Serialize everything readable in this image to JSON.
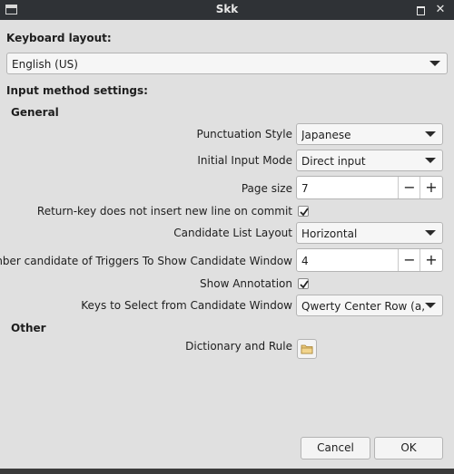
{
  "window": {
    "title": "Skk"
  },
  "keyboard": {
    "label": "Keyboard layout:",
    "selected": "English (US)"
  },
  "settings": {
    "heading": "Input method settings:",
    "general": {
      "heading": "General",
      "punctuation_style": {
        "label": "Punctuation Style",
        "value": "Japanese"
      },
      "initial_input_mode": {
        "label": "Initial Input Mode",
        "value": "Direct input"
      },
      "page_size": {
        "label": "Page size",
        "value": "7"
      },
      "return_key": {
        "label": "Return-key does not insert new line on commit",
        "checked": true
      },
      "candidate_list_layout": {
        "label": "Candidate List Layout",
        "value": "Horizontal"
      },
      "number_candidate": {
        "label": "Number candidate of Triggers To Show Candidate Window",
        "value": "4"
      },
      "show_annotation": {
        "label": "Show Annotation",
        "checked": true
      },
      "keys_to_select": {
        "label": "Keys to Select from Candidate Window",
        "value": "Qwerty Center Row (a,s,d,...)"
      }
    },
    "other": {
      "heading": "Other",
      "dictionary_and_rule": {
        "label": "Dictionary and Rule",
        "icon": "folder-icon"
      }
    }
  },
  "buttons": {
    "minus": "−",
    "plus": "+",
    "cancel": "Cancel",
    "ok": "OK"
  },
  "colors": {
    "titlebar": "#2f3236",
    "background": "#e0e0e0",
    "input": "#ffffff"
  }
}
